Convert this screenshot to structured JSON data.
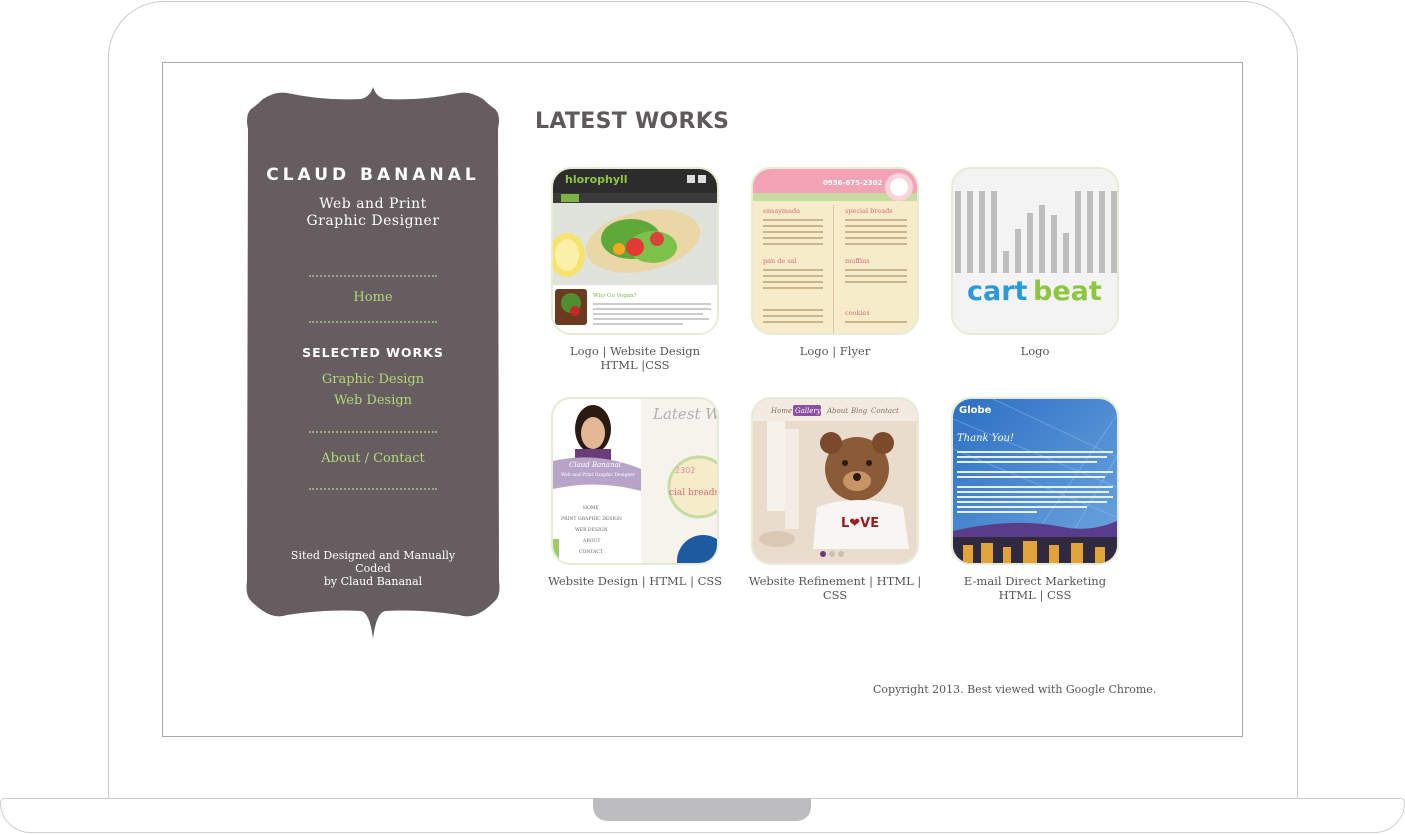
{
  "sidebar": {
    "brand": "CLAUD BANANAL",
    "tagline": "Web and Print Graphic Designer",
    "nav_home": "Home",
    "section_heading": "SELECTED WORKS",
    "nav_graphic_design": "Graphic Design",
    "nav_web_design": "Web Design",
    "nav_about_contact": "About / Contact",
    "footer_line1": "Sited Designed and Manually Coded",
    "footer_line2": "by Claud Bananal"
  },
  "main": {
    "title": "LATEST WORKS",
    "works": [
      {
        "line1": "Logo | Website Design",
        "line2": "HTML |CSS"
      },
      {
        "line1": "Logo | Flyer",
        "line2": ""
      },
      {
        "line1": "Logo",
        "line2": ""
      },
      {
        "line1": "Website Design | HTML | CSS",
        "line2": ""
      },
      {
        "line1": "Website Refinement | HTML | CSS",
        "line2": ""
      },
      {
        "line1": "E-mail Direct Marketing",
        "line2": "HTML | CSS"
      }
    ],
    "thumbs": {
      "chlorophyll_logo": "hlorophyll",
      "chlorophyll_tagline": "Why Go Vegan?",
      "cartbeat_logo_part1": "cart",
      "cartbeat_logo_part2": "beat",
      "portfolio_heading": "Latest W",
      "portfolio_name": "Claud Bananal",
      "portfolio_tag": "Web and Print Graphic Designer",
      "portfolio_links": [
        "HOME",
        "PRINT GRAPHIC DESIGN",
        "WEB DESIGN",
        "ABOUT",
        "CONTACT"
      ],
      "menu_phone": "0936-675-2302",
      "menu_phone_small": "2302",
      "menu_bread": "cial breads",
      "menu_sections": [
        "ensaymada",
        "special breads",
        "pan de sal",
        "muffins",
        "cookies"
      ],
      "gallery_nav": [
        "Home",
        "Gallery",
        "About",
        "Blog",
        "Contact"
      ],
      "gallery_shirt_text": "L❤VE",
      "globe_logo": "Globe",
      "globe_thank": "Thank You!"
    }
  },
  "footer": {
    "copyright": "Copyright 2013. Best viewed with Google Chrome."
  },
  "colors": {
    "sidebar_bg": "#655d5f",
    "nav_link": "#b5d77c",
    "title": "#5e5a5b",
    "cartbeat_blue": "#2a9bd8",
    "cartbeat_green": "#8dc63f"
  }
}
